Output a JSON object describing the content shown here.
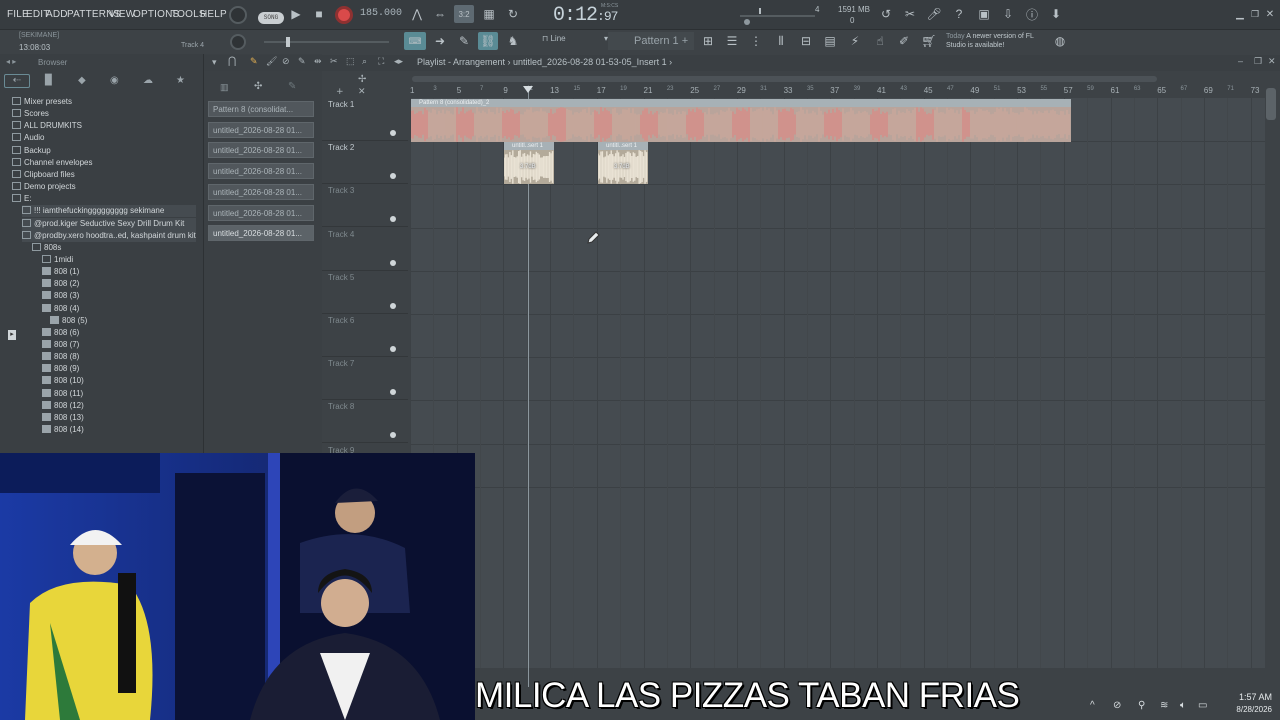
{
  "menu": [
    "FILE",
    "EDIT",
    "ADD",
    "PATTERNS",
    "VIEW",
    "OPTIONS",
    "TOOLS",
    "HELP"
  ],
  "transport": {
    "song_label": "SONG",
    "tempo": "185.000",
    "time_main": "0:12",
    "time_sub": ":97",
    "time_label": "M:S:CS"
  },
  "monitor": {
    "cpu": "4",
    "memory": "1591 MB",
    "polyphony": "0"
  },
  "hint": {
    "title": "[SEKIMANE]",
    "time": "13:08:03",
    "track": "Track 4"
  },
  "toolbar2": {
    "snap": "Line",
    "pattern": "Pattern 1",
    "news_today": "Today",
    "news_text": "A newer version of FL Studio is available!"
  },
  "browser": {
    "title": "Browser",
    "items": [
      {
        "label": "Mixer presets",
        "icon": "mixer-icon"
      },
      {
        "label": "Scores",
        "icon": "scores-icon"
      },
      {
        "label": "ALL DRUMKITS",
        "icon": "folder-icon"
      },
      {
        "label": "Audio",
        "icon": "audio-icon"
      },
      {
        "label": "Backup",
        "icon": "folder-icon"
      },
      {
        "label": "Channel envelopes",
        "icon": "folder-icon"
      },
      {
        "label": "Clipboard files",
        "icon": "folder-icon"
      },
      {
        "label": "Demo projects",
        "icon": "folder-icon"
      },
      {
        "label": "E:",
        "icon": "drive-icon"
      },
      {
        "label": "!!! iamthefuckinggggggggg sekimane",
        "icon": "folder-icon"
      },
      {
        "label": "@prod.kiger Seductive Sexy Drill Drum Kit",
        "icon": "folder-icon"
      },
      {
        "label": "@prodby.xero hoodtra..ed, kashpaint drum kit",
        "icon": "folder-icon"
      },
      {
        "label": "808s",
        "icon": "folder-icon"
      },
      {
        "label": "1midi",
        "icon": "folder-icon"
      },
      {
        "label": "808 (1)",
        "icon": "wave-icon"
      },
      {
        "label": "808 (2)",
        "icon": "wave-icon"
      },
      {
        "label": "808 (3)",
        "icon": "wave-icon"
      },
      {
        "label": "808 (4)",
        "icon": "wave-icon"
      },
      {
        "label": "808 (5)",
        "icon": "wave-icon"
      },
      {
        "label": "808 (6)",
        "icon": "wave-icon"
      },
      {
        "label": "808 (7)",
        "icon": "wave-icon"
      },
      {
        "label": "808 (8)",
        "icon": "wave-icon"
      },
      {
        "label": "808 (9)",
        "icon": "wave-icon"
      },
      {
        "label": "808 (10)",
        "icon": "wave-icon"
      },
      {
        "label": "808 (11)",
        "icon": "wave-icon"
      },
      {
        "label": "808 (12)",
        "icon": "wave-icon"
      },
      {
        "label": "808 (13)",
        "icon": "wave-icon"
      },
      {
        "label": "808 (14)",
        "icon": "wave-icon"
      }
    ]
  },
  "picker": [
    "Pattern 8 (consolidat...",
    "untitled_2026-08-28 01...",
    "untitled_2026-08-28 01...",
    "untitled_2026-08-28 01...",
    "untitled_2026-08-28 01...",
    "untitled_2026-08-28 01...",
    "untitled_2026-08-28 01..."
  ],
  "playlist": {
    "title": "Playlist - Arrangement › untitled_2026-08-28 01-53-05_Insert 1 ›",
    "ruler": [
      "1",
      "3",
      "5",
      "7",
      "9",
      "11",
      "13",
      "15",
      "17",
      "19",
      "21",
      "23",
      "25",
      "27",
      "29",
      "31",
      "33",
      "35",
      "37",
      "39",
      "41",
      "43",
      "45",
      "47",
      "49",
      "51",
      "53",
      "55",
      "57",
      "59",
      "61",
      "63",
      "65",
      "67",
      "69",
      "71",
      "73"
    ],
    "tracks": [
      "Track 1",
      "Track 2",
      "Track 3",
      "Track 4",
      "Track 5",
      "Track 6",
      "Track 7",
      "Track 8",
      "Track 9"
    ],
    "clips": [
      {
        "label": "Pattern 8 (consolidated)_2",
        "gain": ""
      },
      {
        "label": "untitl..sert 1",
        "gain": "3.7dB"
      },
      {
        "label": "untitl..sert 1",
        "gain": "3.7dB"
      }
    ]
  },
  "caption": "MILICA LAS PIZZAS TABAN FRIAS",
  "taskbar": {
    "time": "1:57 AM",
    "date": "8/28/2026"
  }
}
